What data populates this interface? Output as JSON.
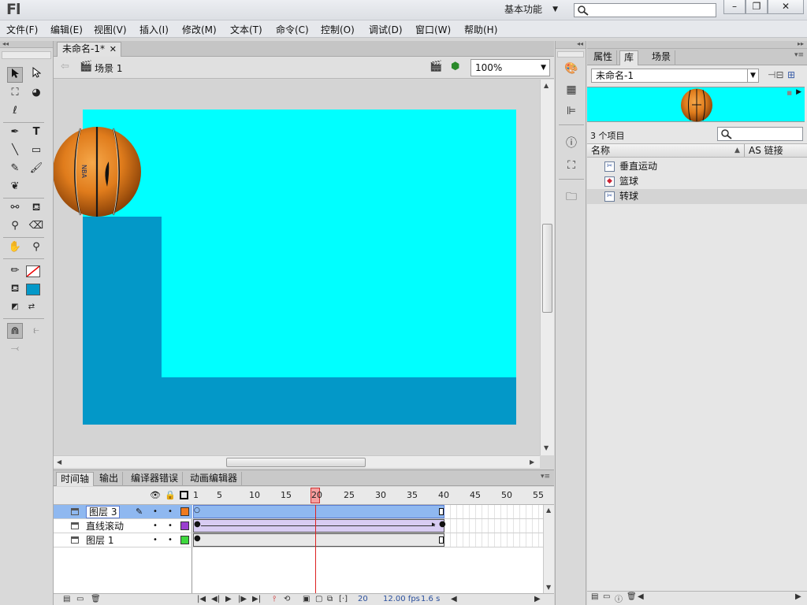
{
  "app": {
    "logo": "Fl",
    "workspace": "基本功能",
    "search_placeholder": ""
  },
  "window": {
    "minimize": "–",
    "restore": "❐",
    "close": "✕"
  },
  "menu": [
    "文件(F)",
    "编辑(E)",
    "视图(V)",
    "插入(I)",
    "修改(M)",
    "文本(T)",
    "命令(C)",
    "控制(O)",
    "调试(D)",
    "窗口(W)",
    "帮助(H)"
  ],
  "document": {
    "tab": "未命名-1*",
    "scene": "场景 1",
    "zoom": "100%",
    "stage_color": "#00ffff",
    "shape_color": "#0398c8",
    "ball_label": "NBA"
  },
  "timeline": {
    "tabs": [
      "时间轴",
      "输出",
      "编译器错误",
      "动画编辑器"
    ],
    "ruler": [
      "1",
      "5",
      "10",
      "15",
      "20",
      "25",
      "30",
      "35",
      "40",
      "45",
      "50",
      "55"
    ],
    "current_frame": "20",
    "layers": [
      {
        "name": "图层 3",
        "color": "#f07a1e",
        "selected": true
      },
      {
        "name": "直线滚动",
        "color": "#9b3fd0",
        "selected": false
      },
      {
        "name": "图层 1",
        "color": "#3ed83e",
        "selected": false
      }
    ],
    "footer": {
      "frame": "20",
      "fps": "12.00 fps",
      "time": "1.6 s"
    }
  },
  "library": {
    "tabs": [
      "属性",
      "库",
      "场景"
    ],
    "document": "未命名-1",
    "count": "3 个项目",
    "col_name": "名称",
    "col_link": "AS 链接",
    "items": [
      {
        "name": "垂直运动",
        "selected": false
      },
      {
        "name": "篮球",
        "selected": false
      },
      {
        "name": "转球",
        "selected": true
      }
    ]
  }
}
